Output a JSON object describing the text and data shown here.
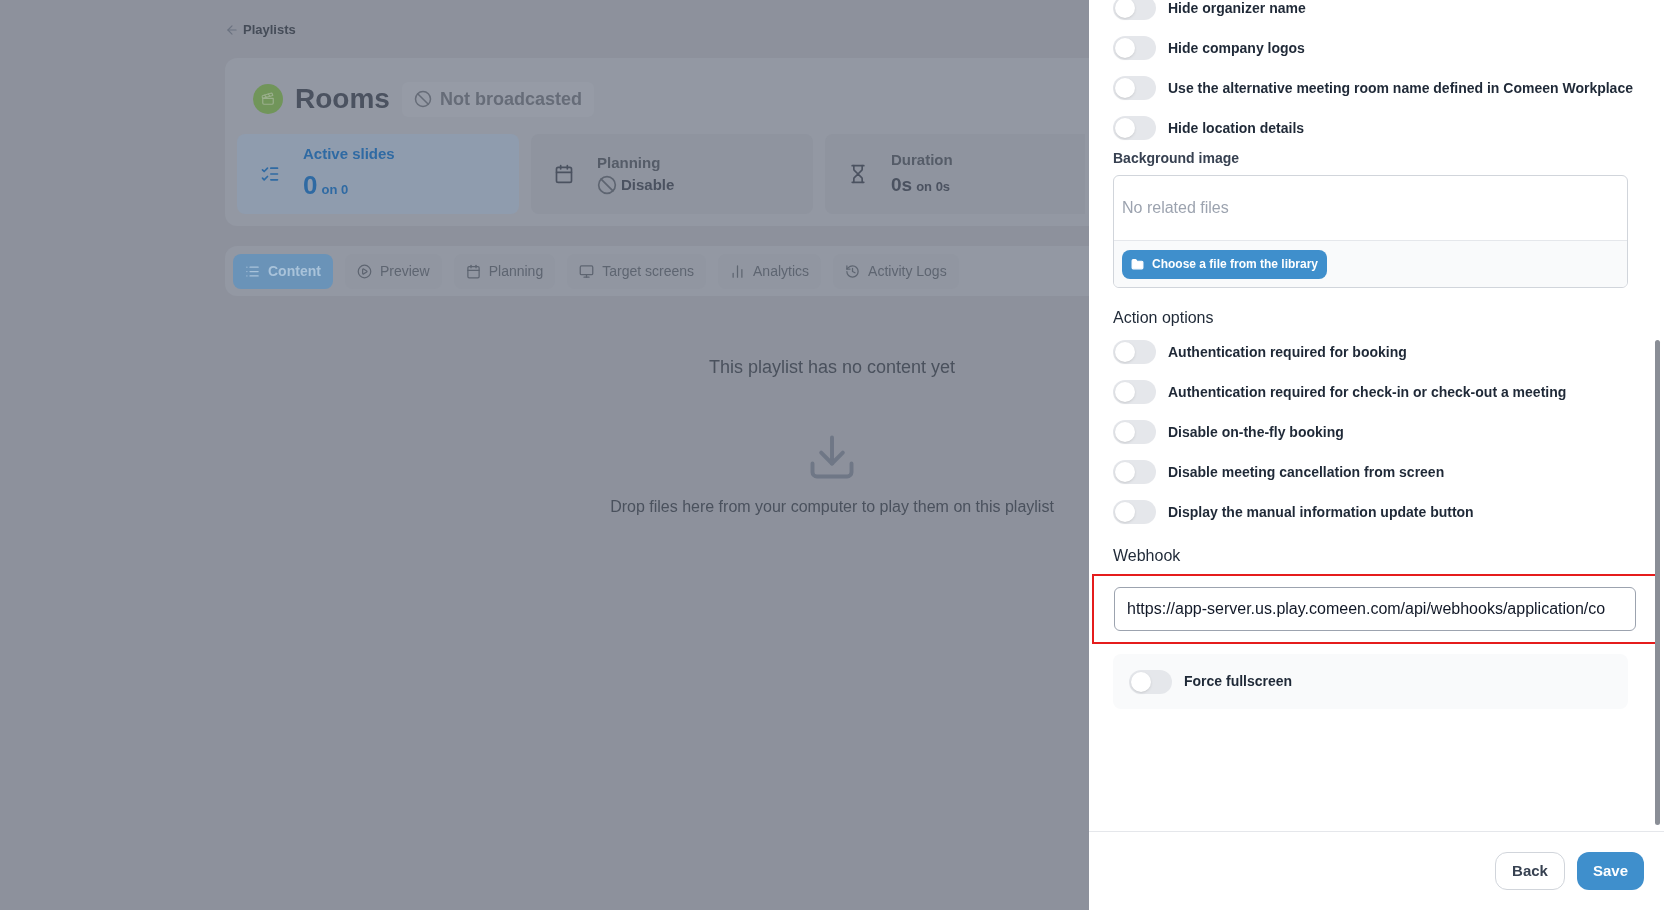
{
  "breadcrumb": {
    "label": "Playlists"
  },
  "playlist": {
    "title": "Rooms",
    "status": "Not broadcasted"
  },
  "stats": [
    {
      "kind": "slides",
      "label": "Active slides",
      "value": "0",
      "suffix": "on 0",
      "selected": true
    },
    {
      "kind": "planning",
      "label": "Planning",
      "value": "Disable",
      "selected": false
    },
    {
      "kind": "duration",
      "label": "Duration",
      "value": "0s",
      "suffix": "on 0s",
      "selected": false
    }
  ],
  "tabs": [
    {
      "kind": "list",
      "label": "Content",
      "selected": true
    },
    {
      "kind": "play",
      "label": "Preview",
      "selected": false
    },
    {
      "kind": "calendar",
      "label": "Planning",
      "selected": false
    },
    {
      "kind": "monitor",
      "label": "Target screens",
      "selected": false
    },
    {
      "kind": "chart",
      "label": "Analytics",
      "selected": false
    },
    {
      "kind": "history",
      "label": "Activity Logs",
      "selected": false
    }
  ],
  "empty_state": {
    "title": "This playlist has no content yet",
    "hint": "Drop files here from your computer to play them on this playlist"
  },
  "panel": {
    "display_options": [
      {
        "label": "Hide organizer name",
        "on": false
      },
      {
        "label": "Hide company logos",
        "on": false
      },
      {
        "label": "Use the alternative meeting room name defined in Comeen Workplace",
        "on": false
      },
      {
        "label": "Hide location details",
        "on": false
      }
    ],
    "background_image": {
      "label": "Background image",
      "empty_text": "No related files",
      "button": "Choose a file from the library"
    },
    "action_options_title": "Action options",
    "action_options": [
      {
        "label": "Authentication required for booking",
        "on": false
      },
      {
        "label": "Authentication required for check-in or check-out a meeting",
        "on": false
      },
      {
        "label": "Disable on-the-fly booking",
        "on": false
      },
      {
        "label": "Disable meeting cancellation from screen",
        "on": false
      },
      {
        "label": "Display the manual information update button",
        "on": false
      }
    ],
    "webhook": {
      "label": "Webhook",
      "value": "https://app-server.us.play.comeen.com/api/webhooks/application/co",
      "highlighted": true
    },
    "force_fullscreen": {
      "label": "Force fullscreen",
      "on": false
    },
    "buttons": [
      {
        "kind": "secondary",
        "label": "Back"
      },
      {
        "kind": "primary",
        "label": "Save"
      }
    ]
  }
}
